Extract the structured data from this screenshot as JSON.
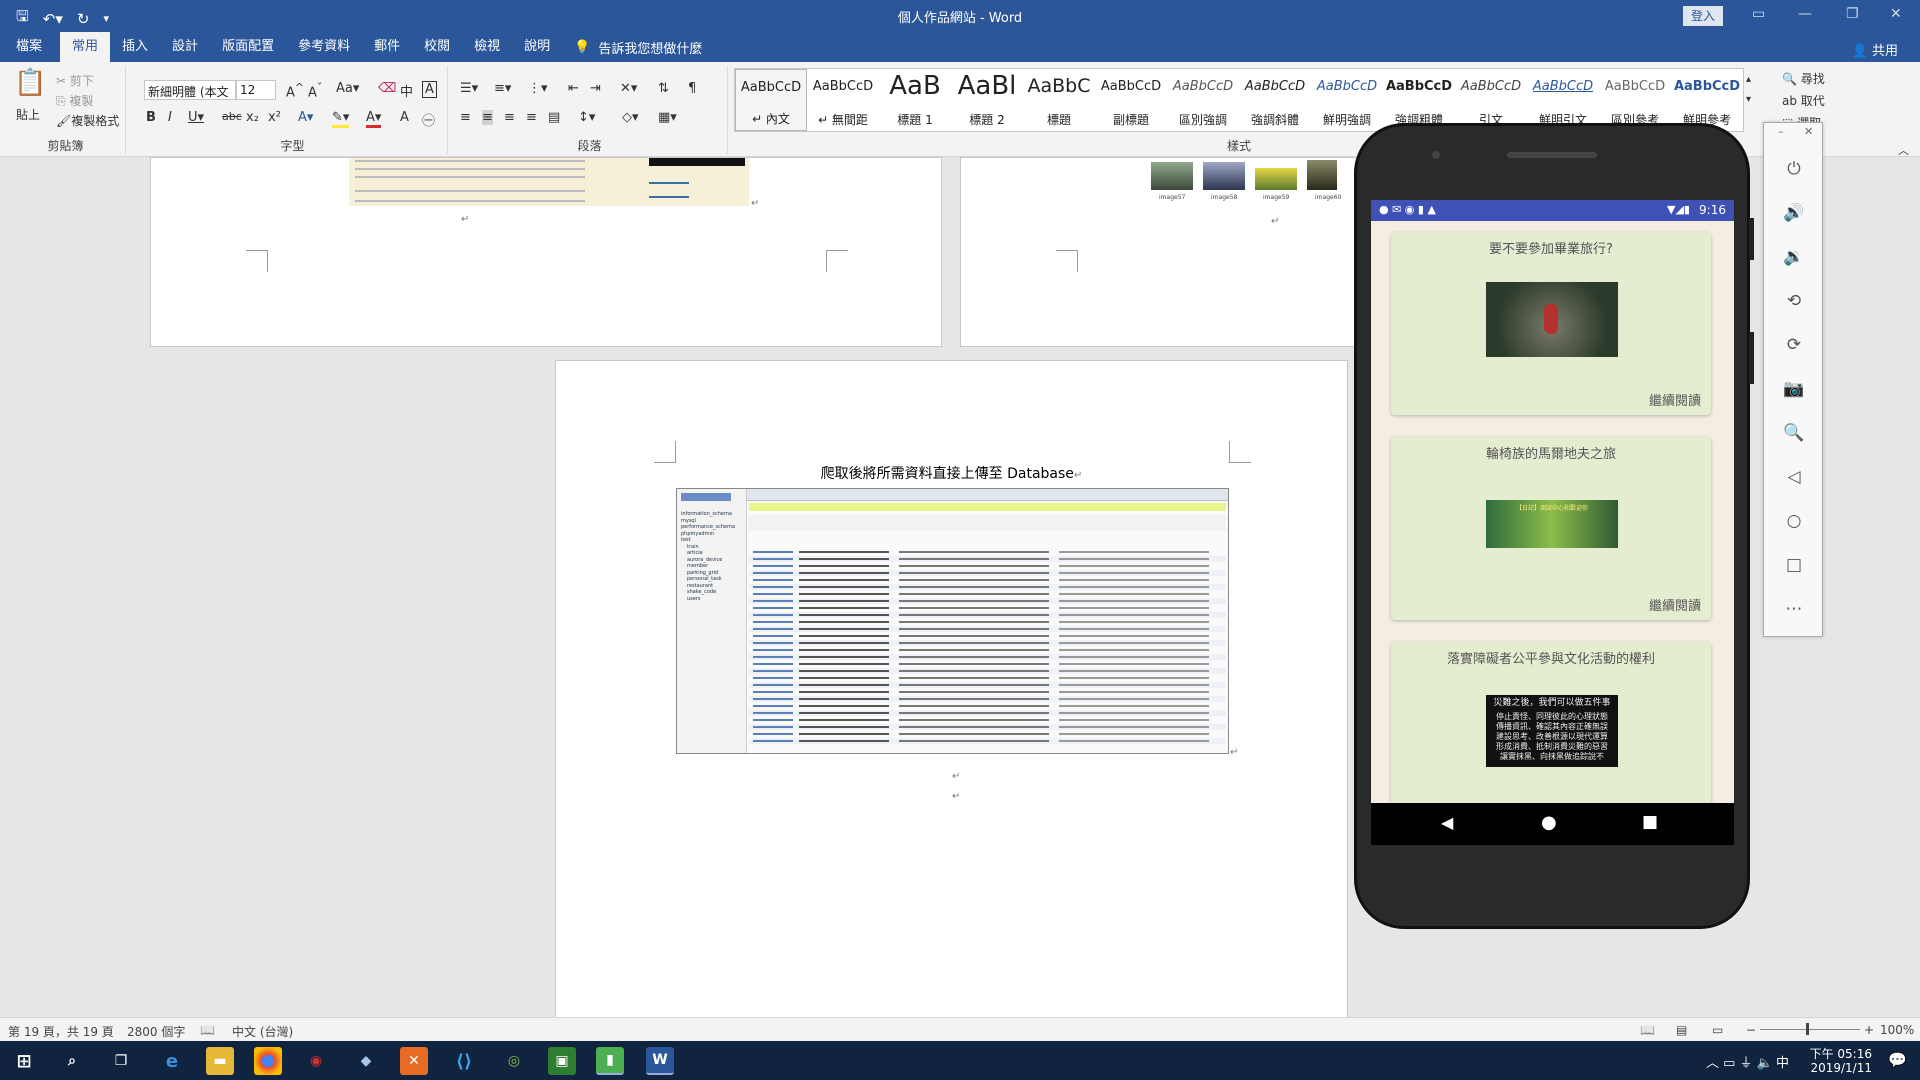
{
  "window": {
    "title": "個人作品網站 - Word",
    "login": "登入"
  },
  "ribbon_tabs": [
    {
      "label": "檔案"
    },
    {
      "label": "常用"
    },
    {
      "label": "插入"
    },
    {
      "label": "設計"
    },
    {
      "label": "版面配置"
    },
    {
      "label": "參考資料"
    },
    {
      "label": "郵件"
    },
    {
      "label": "校閱"
    },
    {
      "label": "檢視"
    },
    {
      "label": "說明"
    }
  ],
  "tellme": "告訴我您想做什麼",
  "share": "共用",
  "clipboard": {
    "paste": "貼上",
    "cut": "剪下",
    "copy": "複製",
    "format_painter": "複製格式",
    "label": "剪貼簿"
  },
  "font": {
    "name": "新細明體 (本文",
    "size": "12",
    "label": "字型"
  },
  "paragraph": {
    "label": "段落"
  },
  "styles": {
    "label": "樣式",
    "items": [
      {
        "preview": "AaBbCcD",
        "name": "↵ 內文"
      },
      {
        "preview": "AaBbCcD",
        "name": "↵ 無間距"
      },
      {
        "preview": "AaB",
        "name": "標題 1"
      },
      {
        "preview": "AaBl",
        "name": "標題 2"
      },
      {
        "preview": "AaBbC",
        "name": "標題"
      },
      {
        "preview": "AaBbCcD",
        "name": "副標題"
      },
      {
        "preview": "AaBbCcD",
        "name": "區別強調"
      },
      {
        "preview": "AaBbCcD",
        "name": "強調斜體"
      },
      {
        "preview": "AaBbCcD",
        "name": "鮮明強調"
      },
      {
        "preview": "AaBbCcD",
        "name": "強調粗體"
      },
      {
        "preview": "AaBbCcD",
        "name": "引文"
      },
      {
        "preview": "AaBbCcD",
        "name": "鮮明引文"
      },
      {
        "preview": "AaBbCcD",
        "name": "區別參考"
      },
      {
        "preview": "AaBbCcD",
        "name": "鮮明參考"
      }
    ]
  },
  "editing": {
    "find": "尋找",
    "replace": "取代",
    "select": "選取"
  },
  "document": {
    "caption": "爬取後將所需資料直接上傳至 Database",
    "para_mark": "↵",
    "thumbs": [
      "image57",
      "image58",
      "image59",
      "image60"
    ],
    "db_sidebar": [
      "information_schema",
      "mysql",
      "performance_schema",
      "phpmyadmin",
      "test",
      "train",
      "article",
      "aurora_device",
      "member",
      "parking_grid",
      "personal_task",
      "restaurant",
      "shake_code",
      "users"
    ],
    "db_rows_count_label": "image"
  },
  "status": {
    "page": "第 19 頁，共 19 頁",
    "words": "2800 個字",
    "lang": "中文 (台灣)",
    "zoom": "100%"
  },
  "taskbar": {
    "time": "下午 05:16",
    "date": "2019/1/11",
    "ime": "中"
  },
  "phone": {
    "time": "9:16",
    "cards": [
      {
        "title": "要不要參加畢業旅行?",
        "more": "繼續閱讀"
      },
      {
        "title": "輪椅族的馬爾地夫之旅",
        "more": "繼續閱讀"
      },
      {
        "title": "落實障礙者公平參與文化活動的權利",
        "more": ""
      }
    ],
    "card3_image_text": [
      "災難之後，我們可以做五件事",
      "停止責怪、同理彼此的心理狀態",
      "傳播資訊、確認其內容正確無誤",
      "建設思考、改善根源以現代運算",
      "形成消費、抵制消費災難的惡習",
      "讓實抹黑、向抹黑做追踪說不"
    ],
    "card2_image_text": "【日記】測試中心和歡迎你"
  },
  "colors": {
    "word_blue": "#2b579a",
    "android_blue": "#3f51b5",
    "card_green": "#e4edd0",
    "taskbar": "#10233f"
  }
}
